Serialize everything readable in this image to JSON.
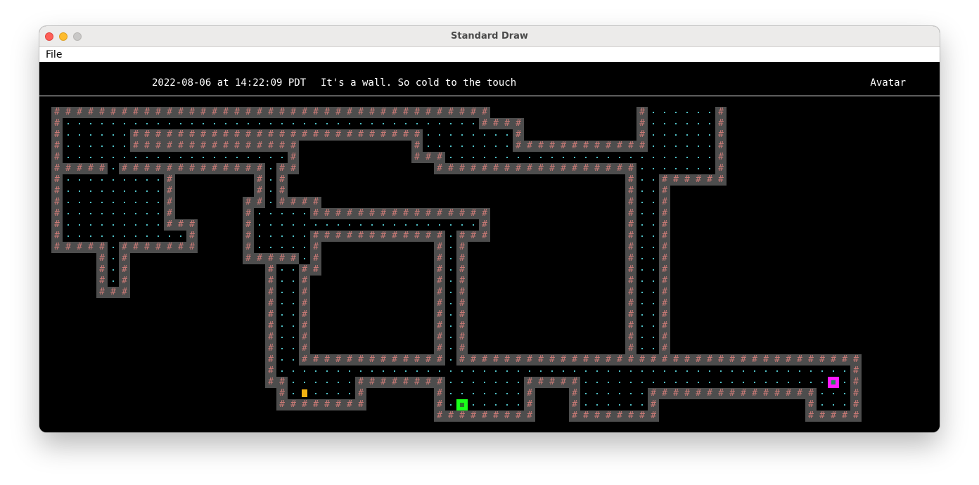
{
  "window": {
    "title": "Standard Draw",
    "menu": [
      "File"
    ]
  },
  "hud": {
    "datetime": "2022-08-06 at 14:22:09 PDT",
    "tile_description": "It's a wall. So cold to the touch",
    "player_name": "Avatar"
  },
  "legend": {
    "wall": "#",
    "avatar": "@"
  },
  "colors": {
    "background": "#000000",
    "wall_bg": "#4d4d4d",
    "wall_glyph": "#c97a76",
    "floor_dot": "#4fc0c6",
    "avatar": "#ffffff",
    "item_yellow": "#f3b212",
    "item_green": "#19ff19",
    "item_magenta": "#ff1aff"
  },
  "map": {
    "rows": [
      "                                                                                                                          ",
      "                                                                ",
      "                                                        #######                                                           ",
      "   ##################################                   #.....#",
      "   #................................######             #.....#",
      "   #......#####################.......#            #######.....#",
      "   #......##############......#..@..###############.........#",
      "   #.....................#...#.........................#.######",
      "   #####.#################...#...................#..#",
      "        #.#              #.#..#                 #..#",
      "        #.#              #.#..#                 #..#",
      "        #.#           ####.##..#                 #..#"
    ]
  }
}
